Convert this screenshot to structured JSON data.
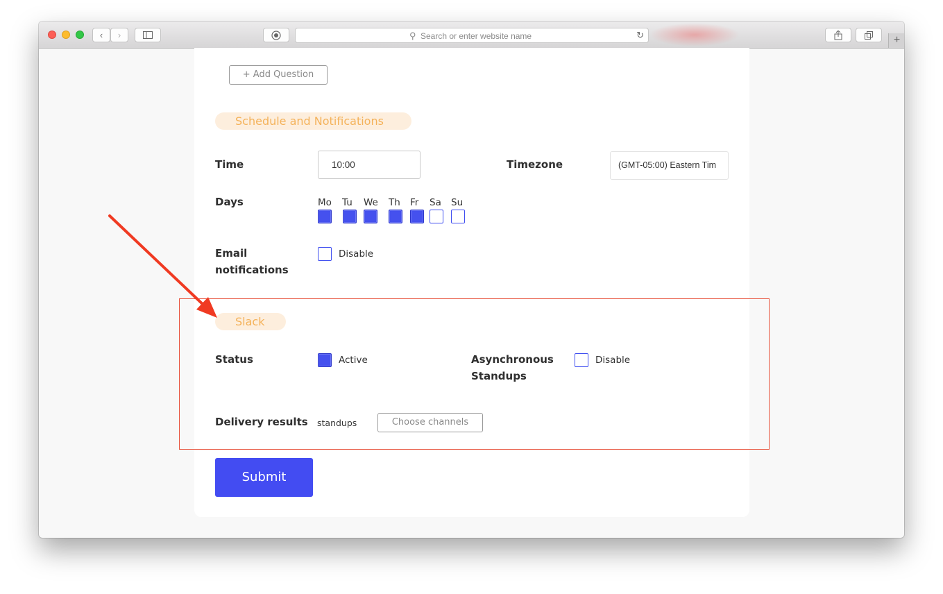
{
  "browser": {
    "url_placeholder": "Search or enter website name",
    "back_icon": "chevron-left-icon",
    "forward_icon": "chevron-right-icon",
    "sidebar_icon": "sidebar-icon",
    "reader_icon": "reader-icon",
    "reload_icon": "reload-icon",
    "share_icon": "share-icon",
    "tabs_icon": "tabs-icon",
    "newtab_label": "+"
  },
  "form": {
    "add_question_label": "+ Add Question",
    "schedule_section_title": "Schedule and Notifications",
    "time_label": "Time",
    "time_value": "10:00",
    "timezone_label": "Timezone",
    "timezone_value": "(GMT-05:00) Eastern Tim",
    "days_label": "Days",
    "days": [
      {
        "label": "Mo",
        "checked": true
      },
      {
        "label": "Tu",
        "checked": true
      },
      {
        "label": "We",
        "checked": true
      },
      {
        "label": "Th",
        "checked": true
      },
      {
        "label": "Fr",
        "checked": true
      },
      {
        "label": "Sa",
        "checked": false
      },
      {
        "label": "Su",
        "checked": false
      }
    ],
    "email_label_line1": "Email",
    "email_label_line2": "notifications",
    "email_option": "Disable",
    "email_checked": false,
    "slack_section_title": "Slack",
    "status_label": "Status",
    "status_option": "Active",
    "status_checked": true,
    "async_label_line1": "Asynchronous",
    "async_label_line2": "Standups",
    "async_option": "Disable",
    "async_checked": false,
    "delivery_label": "Delivery results",
    "delivery_channel": "standups",
    "choose_channels_label": "Choose channels",
    "submit_label": "Submit"
  },
  "colors": {
    "accent": "#434cf2",
    "section_pill_bg": "#fdeedd",
    "section_pill_text": "#f4b25a",
    "annotation": "#e8553f"
  }
}
